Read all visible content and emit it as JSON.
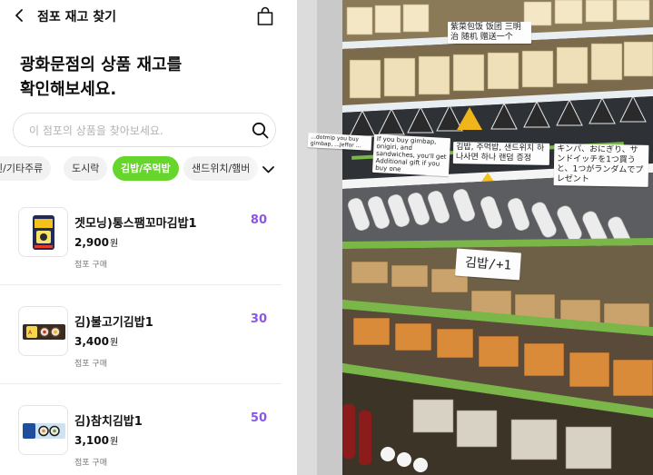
{
  "header": {
    "title": "점포 재고 찾기"
  },
  "headline": {
    "line1": "광화문점의 상품 재고를",
    "line2": "확인해보세요."
  },
  "search": {
    "placeholder": "이 점포의 상품을 찾아보세요."
  },
  "categories": [
    {
      "label": "인/기타주류",
      "active": false
    },
    {
      "label": "도시락",
      "active": false
    },
    {
      "label": "김밥/주먹밥",
      "active": true
    },
    {
      "label": "샌드위치/햄버",
      "active": false
    }
  ],
  "products": [
    {
      "name": "겟모닝)통스팸꼬마김밥1",
      "price": "2,900",
      "currency": "원",
      "purchase": "점포 구매",
      "stock": "80"
    },
    {
      "name": "김)불고기김밥1",
      "price": "3,400",
      "currency": "원",
      "purchase": "점포 구매",
      "stock": "30"
    },
    {
      "name": "김)참치김밥1",
      "price": "3,100",
      "currency": "원",
      "purchase": "점포 구매",
      "stock": "50"
    }
  ],
  "photo": {
    "label_chinese": "紫菜包饭 饭团 三明治 随机 赠送一个",
    "label_english_1": "...dotmip you buy gimbap, ...Jeffor ...",
    "label_english_2": "If you buy gimbap, onigiri, and sandwiches, you'll get Additional gift if you buy one",
    "label_korean": "김밥, 주먹밥, 샌드위치 하나사면 하나 랜덤 증정",
    "label_japanese": "キンパ、おにぎり、サンドイッチを1つ買うと、1つがランダムでプレゼント",
    "sign": "김밥/+1"
  },
  "colors": {
    "accent_green": "#66d62c",
    "stock_purple": "#8a56e8"
  }
}
